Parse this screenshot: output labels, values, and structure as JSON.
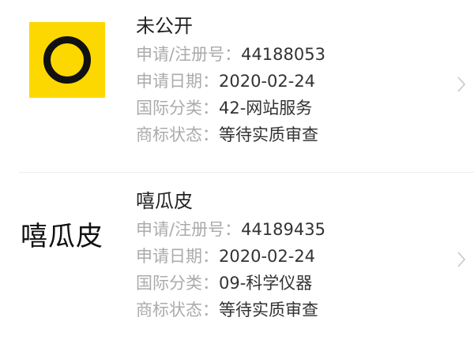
{
  "trademarks": [
    {
      "name": "未公开",
      "logo": "yellow-ring-logo",
      "fields": {
        "reg_no_label": "申请/注册号：",
        "reg_no": "44188053",
        "date_label": "申请日期：",
        "date": "2020-02-24",
        "class_label": "国际分类：",
        "class": "42-网站服务",
        "status_label": "商标状态：",
        "status": "等待实质审查"
      }
    },
    {
      "name": "嘻瓜皮",
      "logo_text": "嘻瓜皮",
      "fields": {
        "reg_no_label": "申请/注册号：",
        "reg_no": "44189435",
        "date_label": "申请日期：",
        "date": "2020-02-24",
        "class_label": "国际分类：",
        "class": "09-科学仪器",
        "status_label": "商标状态：",
        "status": "等待实质审查"
      }
    }
  ],
  "icons": {
    "chevron": "chevron-right-icon"
  },
  "colors": {
    "logo_bg": "#fcd800",
    "label": "#ababab",
    "value": "#333333",
    "title": "#222222"
  }
}
